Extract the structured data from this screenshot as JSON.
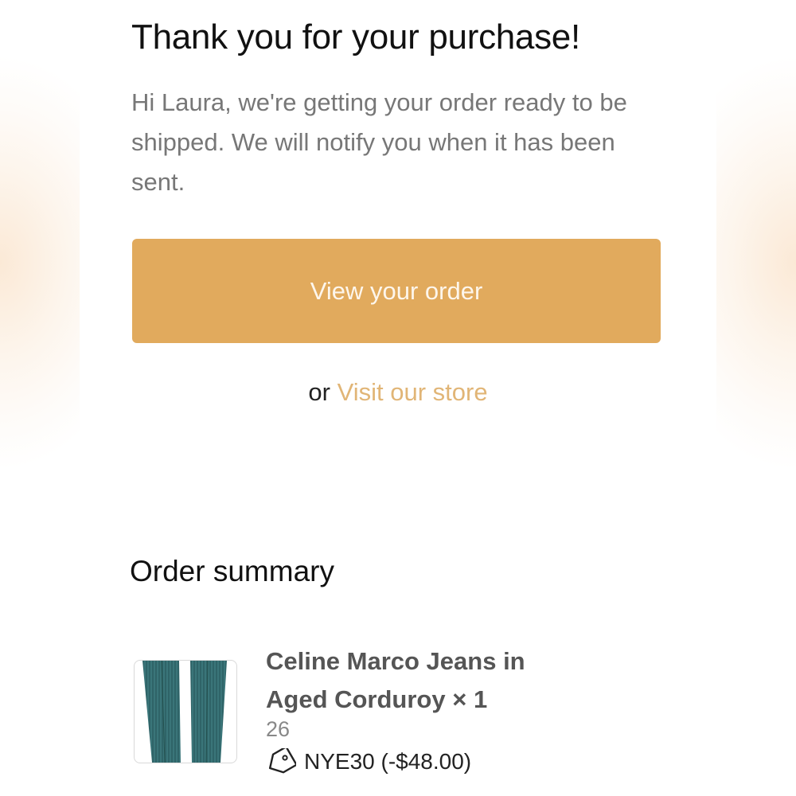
{
  "confirmation": {
    "title": "Thank you for your purchase!",
    "message": "Hi Laura, we're getting your order ready to be shipped. We will notify you when it has been sent.",
    "view_order_label": "View your order",
    "or_text": "or",
    "visit_store_label": "Visit our store"
  },
  "order_summary": {
    "heading": "Order summary",
    "items": [
      {
        "name": "Celine Marco Jeans in Aged Corduroy × 1",
        "variant": "26",
        "discount_code": "NYE30 (-$48.00)",
        "discount_icon": "tag-icon",
        "image": "product-thumbnail"
      }
    ]
  },
  "colors": {
    "accent": "#e1aa5d",
    "link": "#e1b576",
    "muted_text": "#777777",
    "product_teal": "#2f6468"
  }
}
